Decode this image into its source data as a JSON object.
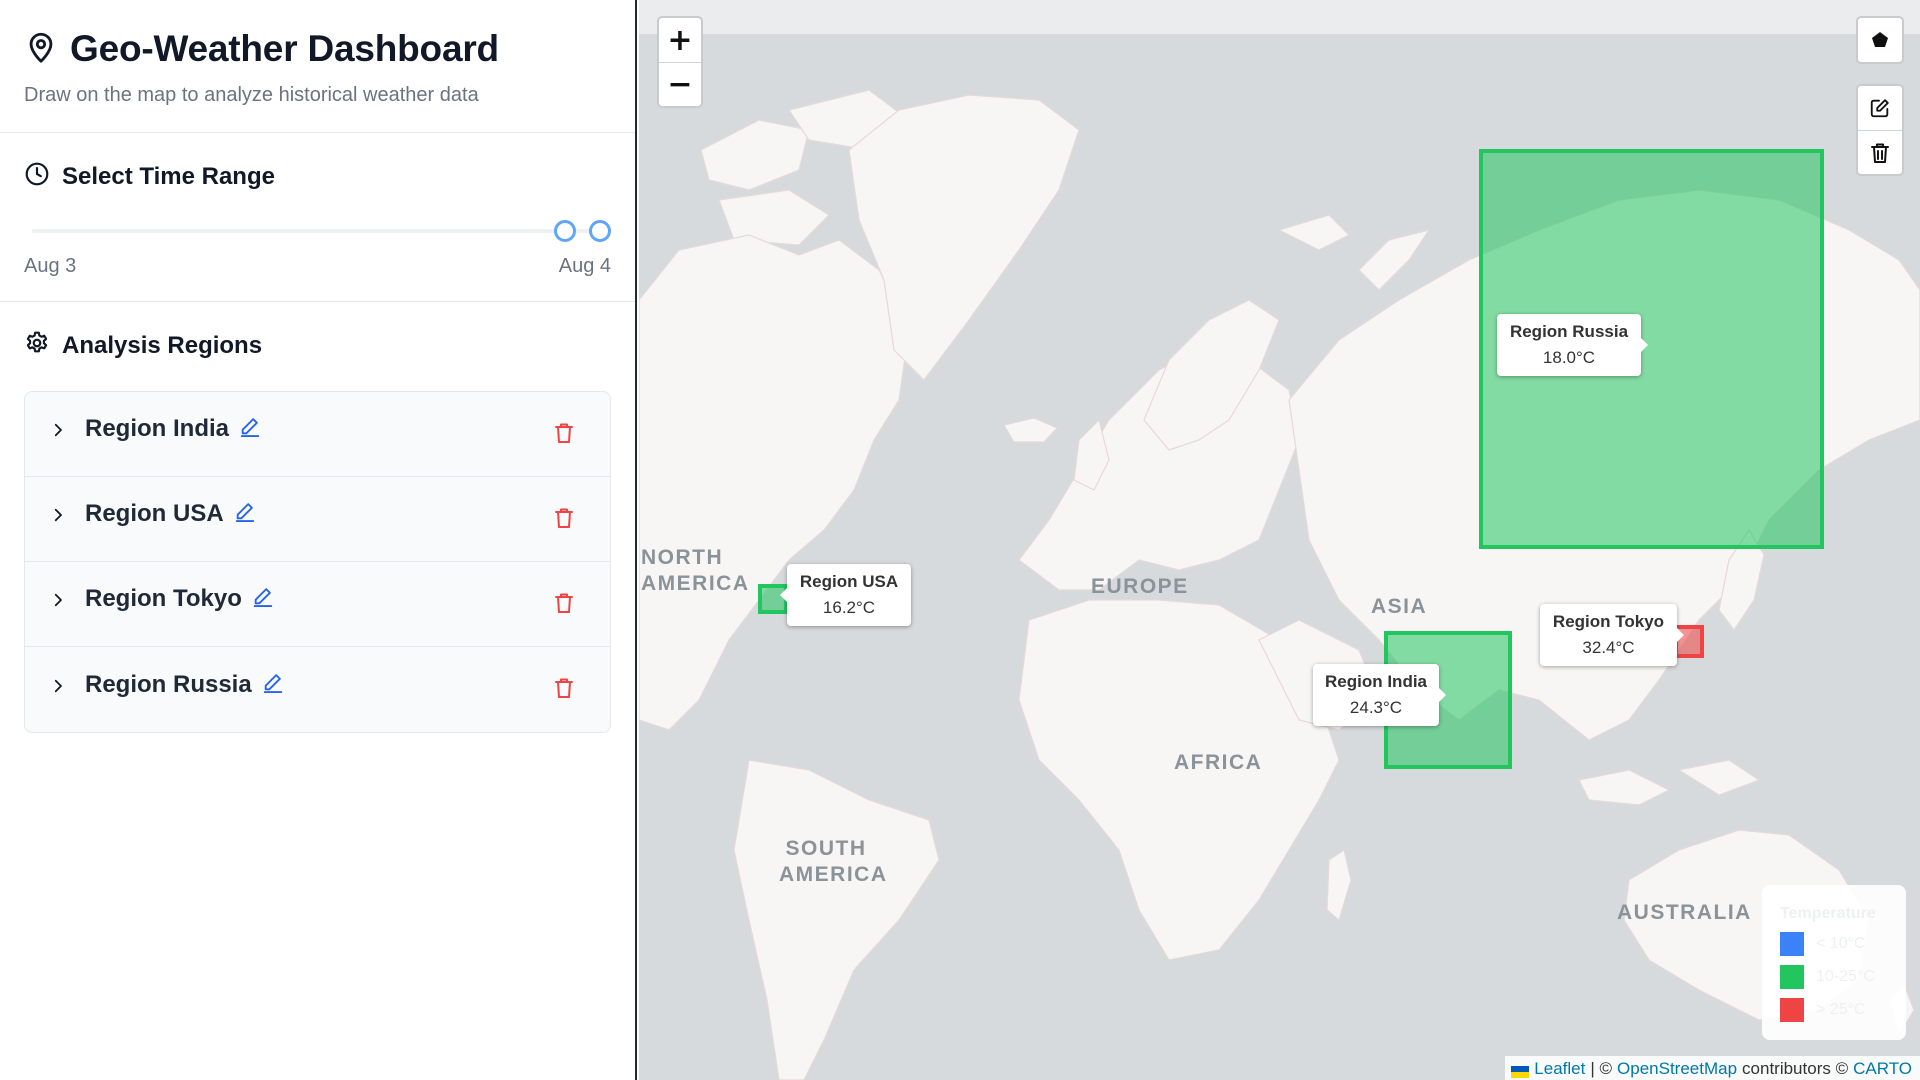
{
  "header": {
    "title": "Geo-Weather Dashboard",
    "subtitle": "Draw on the map to analyze historical weather data"
  },
  "time_range": {
    "title": "Select Time Range",
    "start_label": "Aug 3",
    "end_label": "Aug 4",
    "start_position": 0.97,
    "end_position": 1.0
  },
  "regions_panel": {
    "title": "Analysis Regions",
    "items": [
      {
        "label": "Region India"
      },
      {
        "label": "Region USA"
      },
      {
        "label": "Region Tokyo"
      },
      {
        "label": "Region Russia"
      }
    ]
  },
  "map": {
    "zoom_in": "+",
    "zoom_out": "−",
    "continents": {
      "north_america": "NORTH\nAMERICA",
      "europe": "EUROPE",
      "asia": "ASIA",
      "africa": "AFRICA",
      "south_america": "SOUTH\nAMERICA",
      "australia": "AUSTRALIA"
    },
    "tooltips": [
      {
        "name": "Region Russia",
        "value": "18.0°C"
      },
      {
        "name": "Region USA",
        "value": "16.2°C"
      },
      {
        "name": "Region Tokyo",
        "value": "32.4°C"
      },
      {
        "name": "Region India",
        "value": "24.3°C"
      }
    ],
    "legend": {
      "title": "Temperature",
      "items": [
        {
          "label": "< 10°C",
          "color": "#3b82f6"
        },
        {
          "label": "10-25°C",
          "color": "#22c55e"
        },
        {
          "label": "> 25°C",
          "color": "#ef4444"
        }
      ]
    },
    "attribution": {
      "leaflet": "Leaflet",
      "sep": "| ©",
      "osm": "OpenStreetMap",
      "contrib": "contributors ©",
      "carto": "CARTO"
    }
  },
  "colors": {
    "accent": "#3b82f6",
    "edit": "#2563eb",
    "delete": "#ef4444",
    "region_green": "#22c55e",
    "region_red": "#ef4444"
  }
}
